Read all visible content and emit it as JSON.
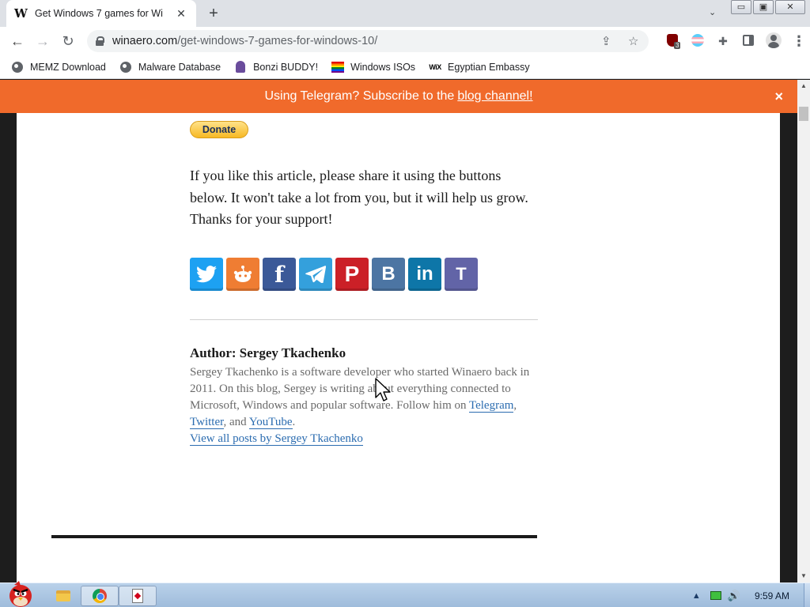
{
  "browser": {
    "tab": {
      "favicon": "W",
      "title": "Get Windows 7 games for Wi"
    },
    "new_tab_label": "+",
    "tab_search_label": "⌄",
    "window_buttons": {
      "minimize": "▭",
      "maximize": "▣",
      "close": "✕"
    },
    "nav": {
      "back": "←",
      "forward": "→",
      "reload": "↻"
    },
    "url": {
      "domain": "winaero.com",
      "path": "/get-windows-7-games-for-windows-10/"
    },
    "omnibox_icons": {
      "share": "⇪",
      "star": "☆"
    },
    "extensions": {
      "ublock_badge": "3",
      "puzzle": "✚",
      "menu": "⋮"
    }
  },
  "bookmarks": [
    {
      "label": "MEMZ Download",
      "icon": "globe-icon"
    },
    {
      "label": "Malware Database",
      "icon": "globe-icon"
    },
    {
      "label": "Bonzi BUDDY!",
      "icon": "bonzi-icon"
    },
    {
      "label": "Windows ISOs",
      "icon": "rainbow-flag-icon"
    },
    {
      "label": "Egyptian Embassy",
      "icon": "wix-icon",
      "icon_text": "WiX"
    }
  ],
  "banner": {
    "text": "Using Telegram? Subscribe to the",
    "link": "blog channel!",
    "close": "×",
    "color": "#f06a2b"
  },
  "article": {
    "donate_label": "Donate",
    "share_text": "If you like this article, please share it using the buttons below. It won't take a lot from you, but it will help us grow. Thanks for your support!",
    "share_buttons": [
      {
        "name": "twitter",
        "color": "#1da1f2"
      },
      {
        "name": "reddit",
        "color": "#ef7d33"
      },
      {
        "name": "facebook",
        "glyph": "f",
        "color": "#3b5998"
      },
      {
        "name": "telegram",
        "color": "#34a0dc"
      },
      {
        "name": "pinterest",
        "glyph": "P",
        "color": "#cb2027"
      },
      {
        "name": "vk",
        "glyph": "B",
        "color": "#4c75a3"
      },
      {
        "name": "linkedin",
        "glyph": "in",
        "color": "#0e76a8"
      },
      {
        "name": "teams",
        "glyph": "T",
        "color": "#6264a7"
      }
    ],
    "author": {
      "title": "Author: Sergey Tkachenko",
      "bio_part1": "Sergey Tkachenko is a software developer who started Winaero back in 2011. On this blog, Sergey is writing about everything connected to Microsoft, Windows and popular software. Follow him on",
      "link_telegram": "Telegram",
      "sep1": ",",
      "link_twitter": "Twitter",
      "sep2": ", and",
      "link_youtube": "YouTube",
      "sep3": ".",
      "view_all": "View all posts by Sergey Tkachenko"
    }
  },
  "taskbar": {
    "clock": "9:59 AM",
    "tray_arrow": "▲",
    "volume": "🔊"
  }
}
